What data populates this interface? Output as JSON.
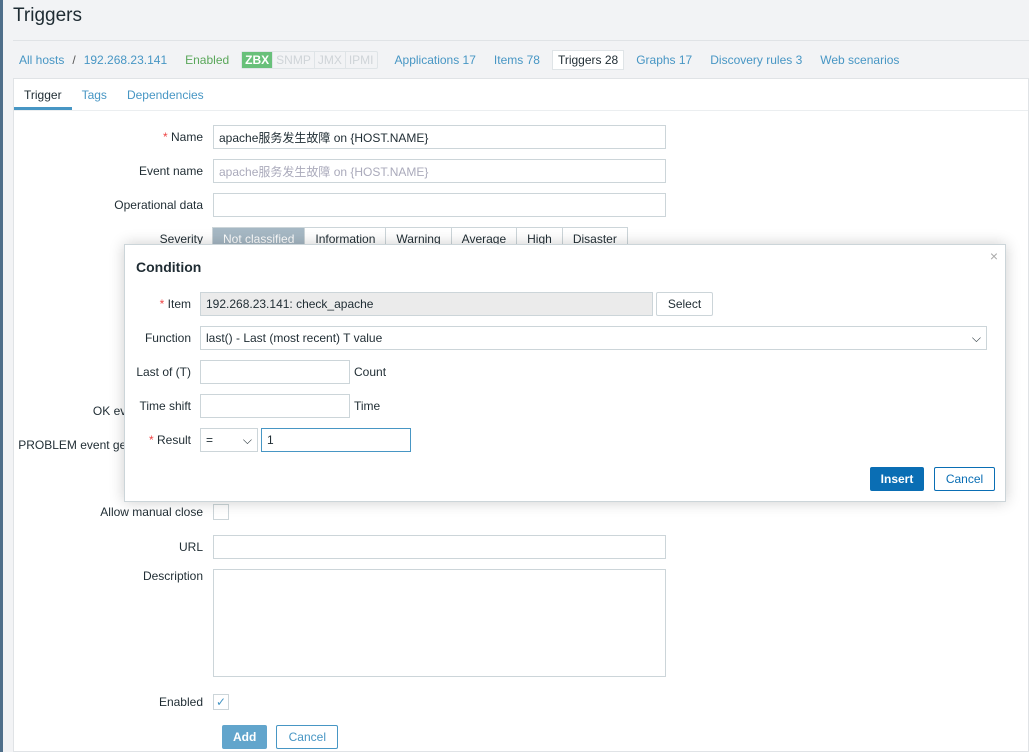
{
  "page": {
    "title": "Triggers"
  },
  "nav": {
    "all_hosts": "All hosts",
    "separator": "/",
    "host": "192.268.23.141",
    "status": "Enabled",
    "badges": [
      "ZBX",
      "SNMP",
      "JMX",
      "IPMI"
    ],
    "links": [
      "Applications 17",
      "Items 78",
      "Triggers 28",
      "Graphs 17",
      "Discovery rules 3",
      "Web scenarios"
    ]
  },
  "tabs": [
    "Trigger",
    "Tags",
    "Dependencies"
  ],
  "form": {
    "name_label": "Name",
    "name_value": "apache服务发生故障 on {HOST.NAME}",
    "event_name_label": "Event name",
    "event_name_placeholder": "apache服务发生故障 on {HOST.NAME}",
    "opdata_label": "Operational data",
    "severity_label": "Severity",
    "severities": [
      "Not classified",
      "Information",
      "Warning",
      "Average",
      "High",
      "Disaster"
    ],
    "ok_label": "OK event generation",
    "problem_label": "PROBLEM event generation mode",
    "manual_close_label": "Allow manual close",
    "url_label": "URL",
    "description_label": "Description",
    "enabled_label": "Enabled",
    "add": "Add",
    "cancel": "Cancel",
    "required": "*",
    "check": "✓"
  },
  "dialog": {
    "title": "Condition",
    "close": "×",
    "item_label": "Item",
    "item_value": "192.268.23.141: check_apache",
    "select": "Select",
    "function_label": "Function",
    "function_value": "last() - Last (most recent) T value",
    "last_of_label": "Last of (T)",
    "count": "Count",
    "time_shift_label": "Time shift",
    "time": "Time",
    "result_label": "Result",
    "result_op": "=",
    "result_value": "1",
    "insert": "Insert",
    "cancel": "Cancel",
    "chevron": "⌵"
  }
}
